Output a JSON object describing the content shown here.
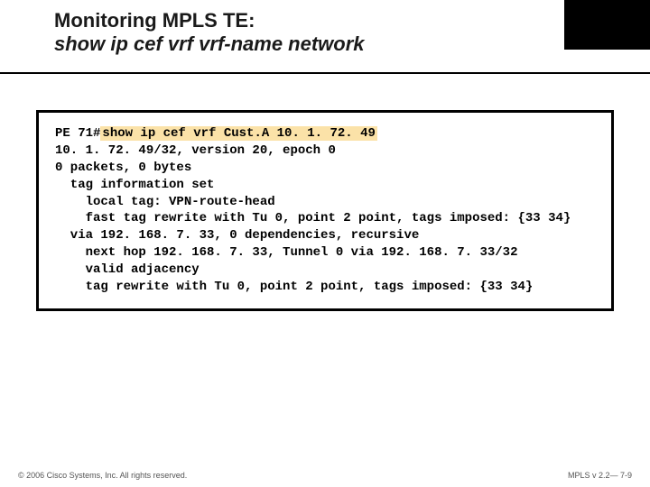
{
  "header": {
    "line1": "Monitoring MPLS TE:",
    "line2": "show ip cef vrf vrf-name network"
  },
  "terminal": {
    "prompt": "PE 71#",
    "command": "show ip cef vrf Cust.A 10. 1. 72. 49",
    "output_lines": [
      "10. 1. 72. 49/32, version 20, epoch 0",
      "0 packets, 0 bytes",
      "  tag information set",
      "    local tag: VPN-route-head",
      "    fast tag rewrite with Tu 0, point 2 point, tags imposed: {33 34}",
      "  via 192. 168. 7. 33, 0 dependencies, recursive",
      "    next hop 192. 168. 7. 33, Tunnel 0 via 192. 168. 7. 33/32",
      "    valid adjacency",
      "    tag rewrite with Tu 0, point 2 point, tags imposed: {33 34}"
    ]
  },
  "footer": {
    "left": "© 2006 Cisco Systems, Inc. All rights reserved.",
    "right": "MPLS v 2.2— 7-9"
  }
}
